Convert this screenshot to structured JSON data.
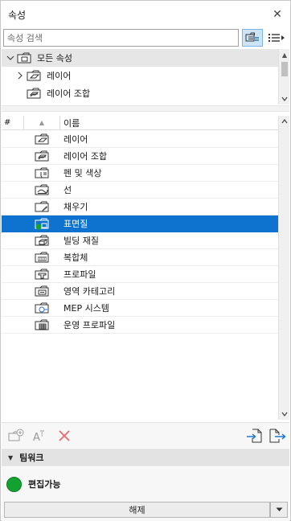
{
  "panel": {
    "title": "속성",
    "close_glyph": "✕"
  },
  "search": {
    "placeholder": "속성 검색",
    "value": ""
  },
  "view_buttons": {
    "tree_view_icon": "tree-view-icon",
    "list_view_icon": "list-view-icon"
  },
  "tree": {
    "items": [
      {
        "label": "모든 속성",
        "icon": "folder-all-icon",
        "expanded": true
      },
      {
        "label": "레이어",
        "icon": "folder-layer-icon",
        "expanded": false
      },
      {
        "label": "레이어 조합",
        "icon": "folder-layer-combo-icon",
        "expanded": false
      }
    ]
  },
  "table": {
    "columns": {
      "number": "#",
      "name": "이름"
    },
    "rows": [
      {
        "name": "레이어",
        "icon": "layers-folder-icon"
      },
      {
        "name": "레이어 조합",
        "icon": "layer-combination-folder-icon"
      },
      {
        "name": "펜 및 색상",
        "icon": "pen-color-folder-icon"
      },
      {
        "name": "선",
        "icon": "line-folder-icon"
      },
      {
        "name": "채우기",
        "icon": "fill-folder-icon"
      },
      {
        "name": "표면질",
        "icon": "surface-folder-icon",
        "selected": true
      },
      {
        "name": "빌딩 재질",
        "icon": "building-material-folder-icon"
      },
      {
        "name": "복합체",
        "icon": "composite-folder-icon"
      },
      {
        "name": "프로파일",
        "icon": "profile-folder-icon"
      },
      {
        "name": "영역 카테고리",
        "icon": "zone-category-folder-icon"
      },
      {
        "name": "MEP 시스템",
        "icon": "mep-system-folder-icon"
      },
      {
        "name": "운영 프로파일",
        "icon": "operation-profile-folder-icon"
      }
    ]
  },
  "toolbar": {
    "new_folder_icon": "new-folder-icon",
    "rename_icon": "rename-icon",
    "delete_icon": "delete-icon",
    "import_icon": "import-icon",
    "export_icon": "export-icon"
  },
  "teamwork": {
    "header": "팀워크",
    "status_label": "편집가능",
    "status_color": "#13a232",
    "release_button": "해제"
  },
  "colors": {
    "selection": "#0d73cf",
    "active_view_button": "#cde4f7"
  }
}
